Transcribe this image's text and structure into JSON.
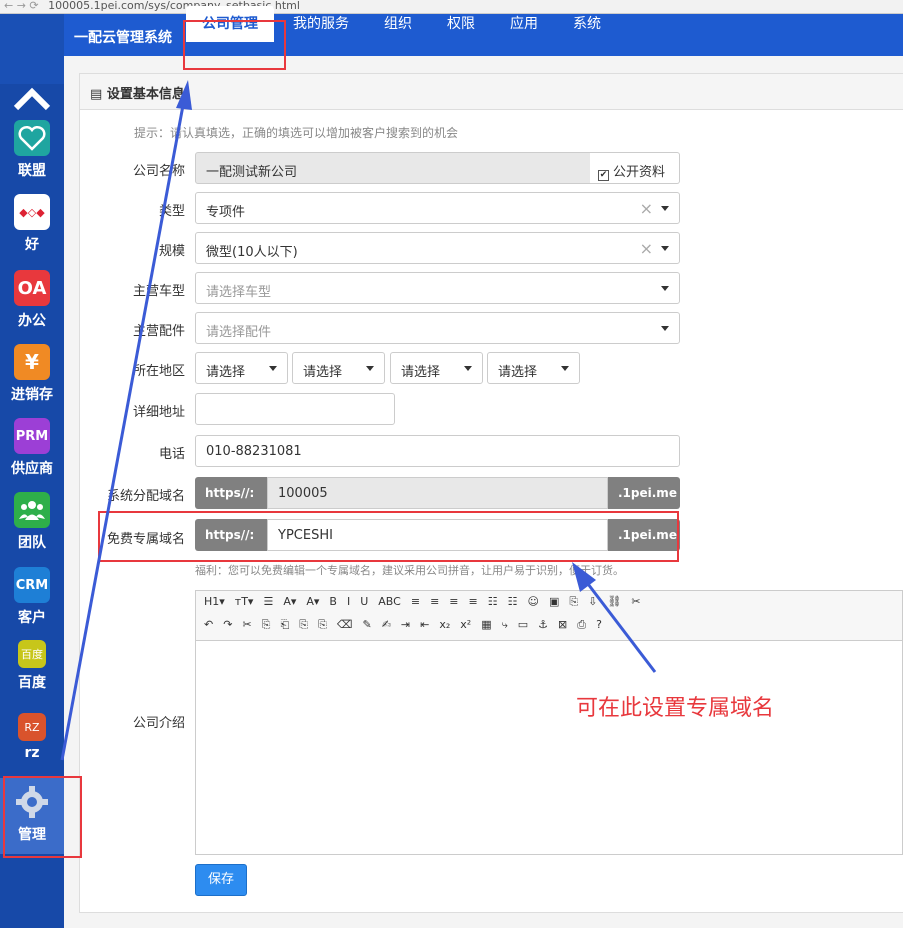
{
  "browser": {
    "nav": "← → ⟳",
    "url": "100005.1pei.com/sys/company_setbasic.html"
  },
  "sidebar": {
    "items": [
      {
        "label": "联盟",
        "icon": "handshake-heart-icon",
        "color": "#1fa5a0"
      },
      {
        "label": "好",
        "icon": "colorful-logo-icon",
        "color": "#ffffff"
      },
      {
        "label": "办公",
        "icon_text": "OA",
        "color": "#e8383d"
      },
      {
        "label": "进销存",
        "icon_text": "¥",
        "color": "#f08a24"
      },
      {
        "label": "供应商",
        "icon_text": "PRM",
        "color": "#9c3fd6"
      },
      {
        "label": "团队",
        "icon": "people-icon",
        "color": "#2eaf4a"
      },
      {
        "label": "客户",
        "icon_text": "CRM",
        "color": "#1e7fd6"
      },
      {
        "label": "百度",
        "icon_text": "百度",
        "color": "#c7c61a"
      },
      {
        "label": "rz",
        "icon_text": "RZ",
        "color": "#d9532c"
      },
      {
        "label": "管理",
        "icon": "gear-icon",
        "color": "#3b6cc9"
      }
    ]
  },
  "topnav": {
    "brand": "一配云管理系统",
    "tabs": [
      "公司管理",
      "我的服务",
      "组织",
      "权限",
      "应用",
      "系统"
    ]
  },
  "panel": {
    "title": "设置基本信息",
    "tip": "提示：请认真填选，正确的填选可以增加被客户搜索到的机会"
  },
  "form": {
    "company_name": {
      "label": "公司名称",
      "value": "一配测试新公司",
      "public_label": "公开资料",
      "public_checked": "✔"
    },
    "type": {
      "label": "类型",
      "value": "专项件"
    },
    "scale": {
      "label": "规模",
      "value": "微型(10人以下)"
    },
    "car_type": {
      "label": "主营车型",
      "placeholder": "请选择车型"
    },
    "parts": {
      "label": "主营配件",
      "placeholder": "请选择配件"
    },
    "region": {
      "label": "所在地区",
      "options": [
        "请选择",
        "请选择",
        "请选择",
        "请选择"
      ]
    },
    "address": {
      "label": "详细地址",
      "value": ""
    },
    "phone": {
      "label": "电话",
      "value": "010-88231081"
    },
    "sys_domain": {
      "label": "系统分配域名",
      "prefix": "https//:",
      "value": "100005",
      "suffix": ".1pei.me"
    },
    "free_domain": {
      "label": "免费专属域名",
      "prefix": "https//:",
      "value": "YPCESHI",
      "suffix": ".1pei.me"
    },
    "domain_hint": "福利：您可以免费编辑一个专属域名，建议采用公司拼音，让用户易于识别，便于订货。",
    "intro": {
      "label": "公司介绍"
    }
  },
  "toolbar": {
    "row1": [
      "H1▾",
      "тT▾",
      "☰",
      "A▾",
      "A▾",
      "B",
      "I",
      "U",
      "ABC",
      "≡",
      "≡",
      "≡",
      "≡",
      "☷",
      "☷",
      "☺",
      "▣",
      "⎘",
      "⇩",
      "⛓",
      "✂"
    ],
    "row2": [
      "↶",
      "↷",
      "✂",
      "⎘",
      "⎗",
      "⎘",
      "⎘",
      "⌫",
      "✎",
      "✍",
      "⇥",
      "⇤",
      "x₂",
      "x²",
      "▦",
      "⤷",
      "▭",
      "⚓",
      "⊠",
      "⎙",
      "?"
    ]
  },
  "save_label": "保存",
  "annotation": "可在此设置专属域名",
  "accent": "#1e5bd0",
  "highlight": "#e8383d"
}
